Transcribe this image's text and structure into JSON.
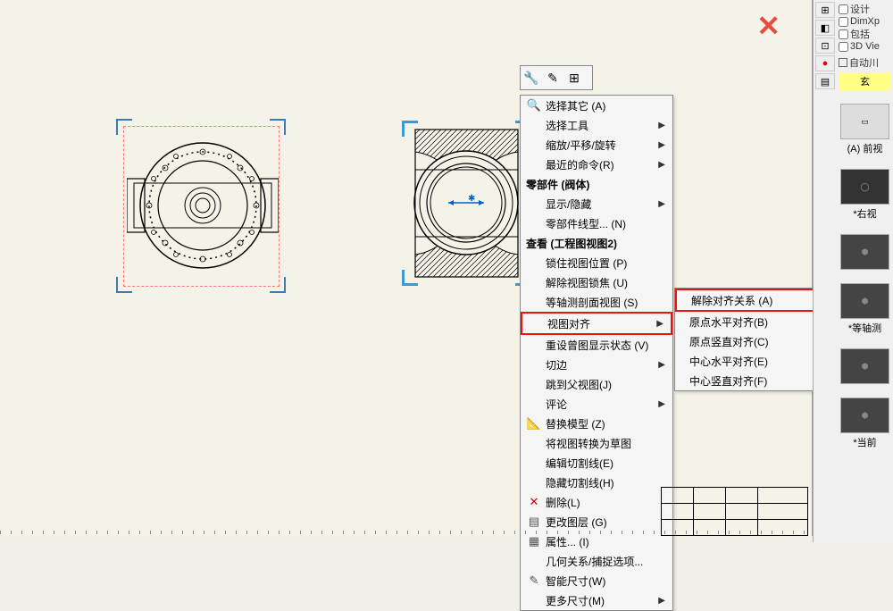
{
  "contextmenu": {
    "items": [
      {
        "label": "选择其它 (A)",
        "arrow": false,
        "icon": "🔍"
      },
      {
        "label": "选择工具",
        "arrow": true
      },
      {
        "label": "缩放/平移/旋转",
        "arrow": true
      },
      {
        "label": "最近的命令(R)",
        "arrow": true
      }
    ],
    "header1": "零部件 (阀体)",
    "items2": [
      {
        "label": "显示/隐藏",
        "arrow": true
      },
      {
        "label": "零部件线型... (N)",
        "arrow": false
      }
    ],
    "header2": "查看 (工程图视图2)",
    "items3": [
      {
        "label": "锁住视图位置 (P)"
      },
      {
        "label": "解除视图锁焦 (U)"
      },
      {
        "label": "等轴测剖面视图 (S)"
      }
    ],
    "highlighted": {
      "label": "视图对齐",
      "arrow": true
    },
    "items4": [
      {
        "label": "重设曾图显示状态 (V)"
      },
      {
        "label": "切边",
        "arrow": true
      },
      {
        "label": "跳到父视图(J)"
      },
      {
        "label": "评论",
        "arrow": true
      },
      {
        "label": "替换模型 (Z)",
        "icon": "📐"
      },
      {
        "label": "将视图转换为草图"
      },
      {
        "label": "编辑切割线(E)"
      },
      {
        "label": "隐藏切割线(H)"
      },
      {
        "label": "删除(L)",
        "icon": "✕"
      },
      {
        "label": "更改图层 (G)",
        "icon": "📋"
      },
      {
        "label": "属性... (I)",
        "icon": "📄"
      },
      {
        "label": "几何关系/捕捉选项..."
      },
      {
        "label": "智能尺寸(W)",
        "icon": "📏"
      },
      {
        "label": "更多尺寸(M)",
        "arrow": true
      }
    ]
  },
  "submenu": {
    "highlighted": "解除对齐关系 (A)",
    "items": [
      "原点水平对齐(B)",
      "原点竖直对齐(C)",
      "中心水平对齐(E)",
      "中心竖直对齐(F)"
    ]
  },
  "rightpanel": {
    "checks": [
      "设计",
      "DimXp",
      "包括",
      "3D Vie"
    ],
    "auto": "自动川",
    "yellow": "玄",
    "thumbs": [
      {
        "label": "(A) 前视"
      },
      {
        "label": "*右视"
      },
      {
        "label": ""
      },
      {
        "label": "*等轴测"
      },
      {
        "label": ""
      },
      {
        "label": "*当前"
      }
    ]
  }
}
